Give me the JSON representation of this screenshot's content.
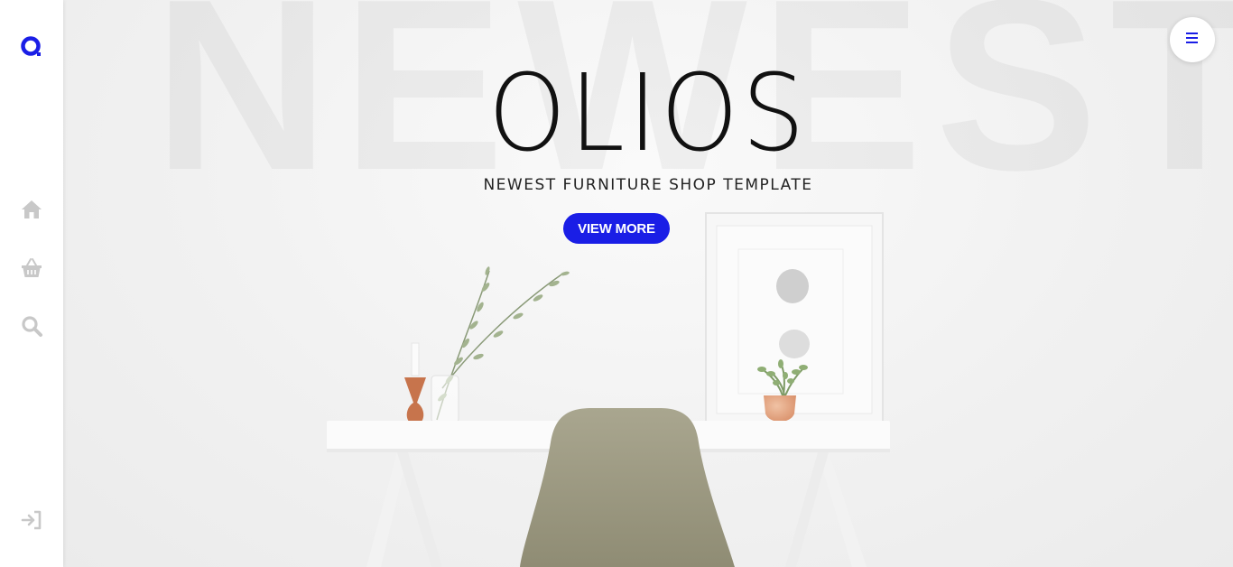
{
  "colors": {
    "accent": "#1a1ee6",
    "sidebar_bg": "#ffffff",
    "icon_gray": "#c8c8c8"
  },
  "sidebar": {
    "logo_icon": "ring-logo-icon",
    "items": [
      {
        "icon": "home-icon"
      },
      {
        "icon": "basket-icon"
      },
      {
        "icon": "search-icon"
      }
    ],
    "bottom_icon": "sign-in-icon"
  },
  "hero": {
    "watermark": "NEWEST",
    "brand": "OLIOS",
    "subtitle": "NEWEST FURNITURE SHOP TEMPLATE",
    "cta_label": "VIEW MORE"
  },
  "menu": {
    "icon": "hamburger-icon"
  }
}
